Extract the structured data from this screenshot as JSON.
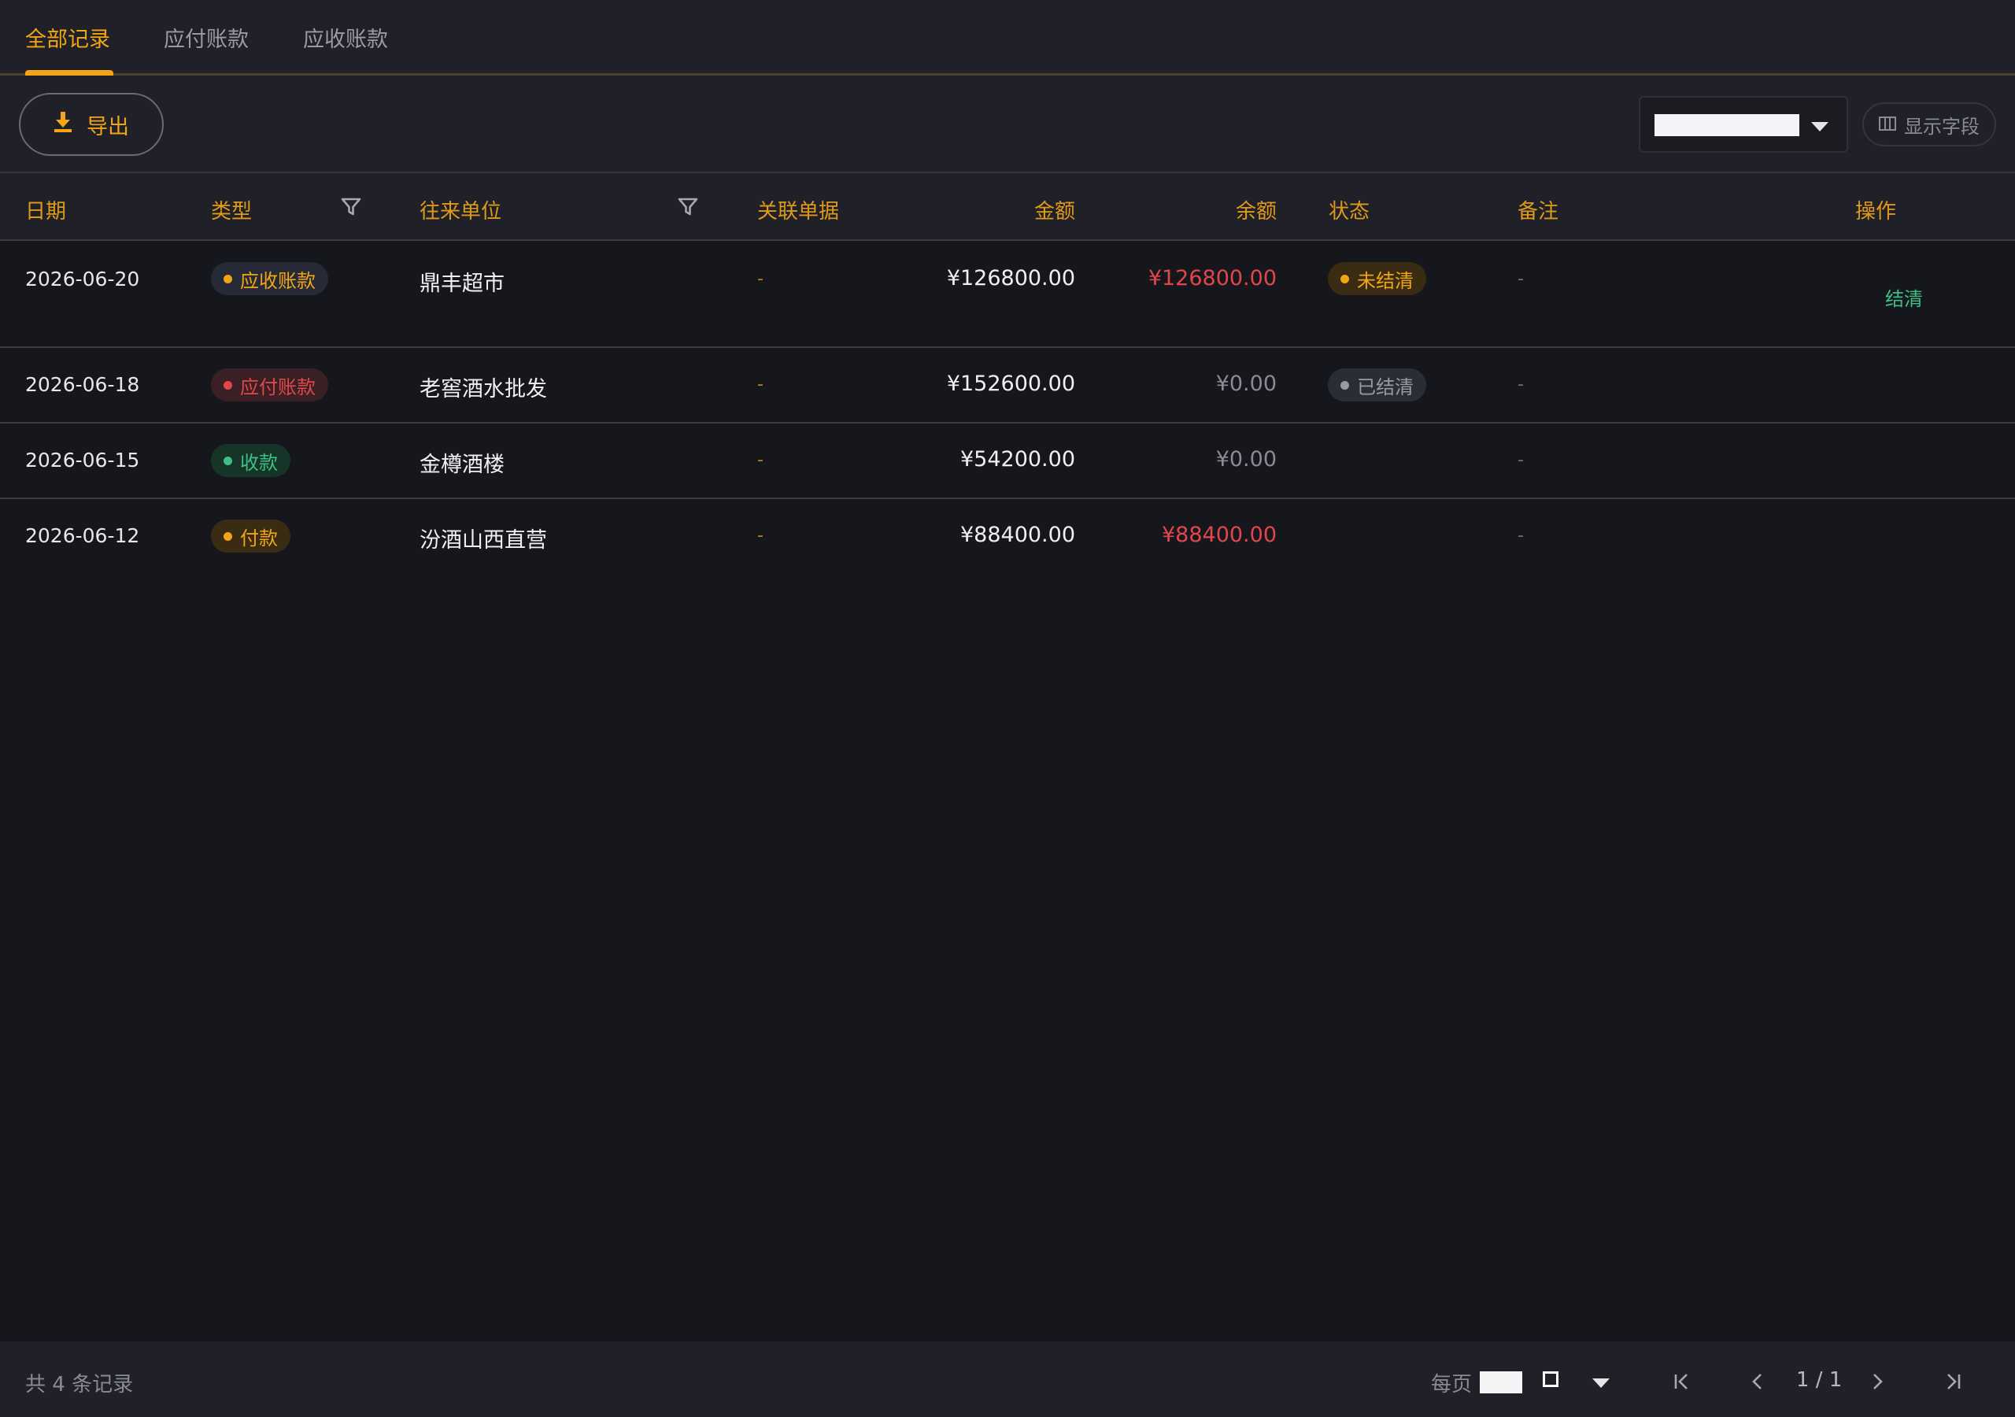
{
  "tabs": [
    {
      "label": "全部记录",
      "active": true
    },
    {
      "label": "应付账款",
      "active": false
    },
    {
      "label": "应收账款",
      "active": false
    }
  ],
  "toolbar": {
    "export_label": "导出",
    "fields_label": "显示字段"
  },
  "table": {
    "headers": {
      "date": "日期",
      "type": "类型",
      "party": "往来单位",
      "document": "关联单据",
      "amount": "金额",
      "balance": "余额",
      "status": "状态",
      "note": "备注",
      "action": "操作"
    },
    "rows": [
      {
        "date": "2026-06-20",
        "type": "应收账款",
        "type_color": "#f2a515",
        "party": "鼎丰超市",
        "document": "-",
        "amount": "¥126800.00",
        "balance": "¥126800.00",
        "balance_color": "#e0474c",
        "status": "未结清",
        "status_color": "#f2a515",
        "note": "-",
        "action": "结清"
      },
      {
        "date": "2026-06-18",
        "type": "应付账款",
        "type_color": "#e0474c",
        "party": "老窖酒水批发",
        "document": "-",
        "amount": "¥152600.00",
        "balance": "¥0.00",
        "balance_color": "#8a8a93",
        "status": "已结清",
        "status_color": "#9a9aa3",
        "note": "-",
        "action": ""
      },
      {
        "date": "2026-06-15",
        "type": "收款",
        "type_color": "#3fbf86",
        "party": "金樽酒楼",
        "document": "-",
        "amount": "¥54200.00",
        "balance": "¥0.00",
        "balance_color": "#8a8a93",
        "status": "",
        "note": "-",
        "action": ""
      },
      {
        "date": "2026-06-12",
        "type": "付款",
        "type_color": "#f2a515",
        "party": "汾酒山西直营",
        "document": "-",
        "amount": "¥88400.00",
        "balance": "¥88400.00",
        "balance_color": "#e0474c",
        "status": "",
        "note": "-",
        "action": ""
      }
    ]
  },
  "footer": {
    "total_text": "共 4 条记录",
    "per_page_label": "每页",
    "page_indicator": "1 / 1"
  },
  "colors": {
    "accent": "#f2a515",
    "danger": "#e0474c",
    "success": "#3fbf86",
    "background": "#16171c",
    "panel": "#1f2028"
  }
}
